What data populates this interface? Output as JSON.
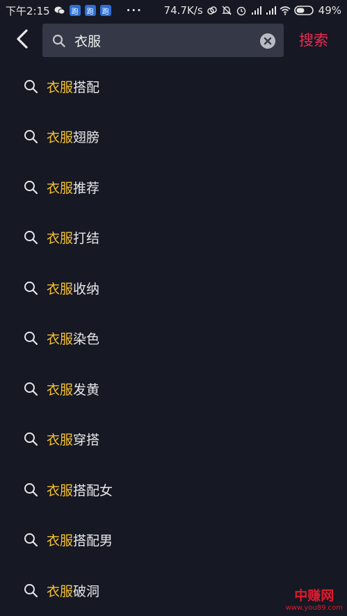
{
  "status_bar": {
    "time": "下午2:15",
    "notification_badges": [
      "跑",
      "跑",
      "跑"
    ],
    "more": "···",
    "net_speed": "74.7K/s",
    "battery": "49%"
  },
  "search": {
    "query": "衣服",
    "submit_label": "搜索"
  },
  "suggestions": [
    {
      "highlight": "衣服",
      "rest": "搭配"
    },
    {
      "highlight": "衣服",
      "rest": "翅膀"
    },
    {
      "highlight": "衣服",
      "rest": "推荐"
    },
    {
      "highlight": "衣服",
      "rest": "打结"
    },
    {
      "highlight": "衣服",
      "rest": "收纳"
    },
    {
      "highlight": "衣服",
      "rest": "染色"
    },
    {
      "highlight": "衣服",
      "rest": "发黄"
    },
    {
      "highlight": "衣服",
      "rest": "穿搭"
    },
    {
      "highlight": "衣服",
      "rest": "搭配女"
    },
    {
      "highlight": "衣服",
      "rest": "搭配男"
    },
    {
      "highlight": "衣服",
      "rest": "破洞"
    }
  ],
  "watermark": {
    "title": "中赚网",
    "url": "www.you89.com"
  },
  "colors": {
    "background": "#161823",
    "search_box": "#353846",
    "highlight": "#f5c130",
    "accent": "#ee2a54"
  }
}
